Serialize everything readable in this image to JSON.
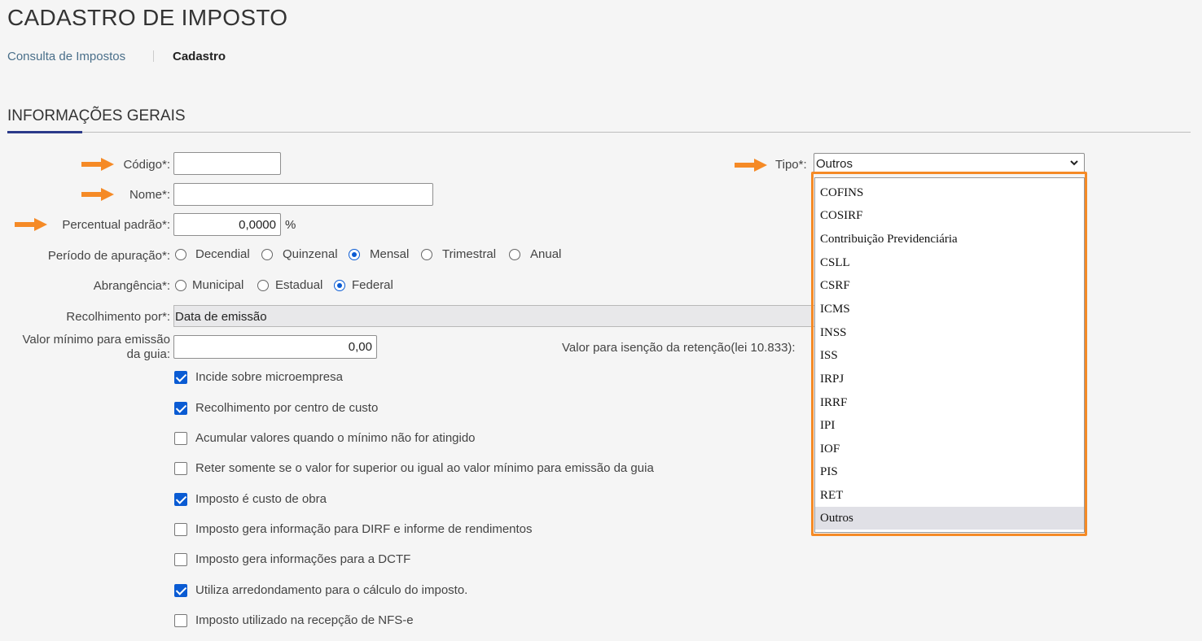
{
  "header": {
    "title": "CADASTRO DE IMPOSTO",
    "breadcrumb_link": "Consulta de Impostos",
    "breadcrumb_current": "Cadastro"
  },
  "section": {
    "title": "INFORMAÇÕES GERAIS"
  },
  "form": {
    "codigo_label": "Código*:",
    "codigo_value": "",
    "nome_label": "Nome*:",
    "nome_value": "",
    "percentual_label": "Percentual padrão*:",
    "percentual_value": "0,0000",
    "percentual_unit": "%",
    "periodo_label": "Período de apuração*:",
    "periodo_options": [
      "Decendial",
      "Quinzenal",
      "Mensal",
      "Trimestral",
      "Anual"
    ],
    "periodo_selected": "Mensal",
    "abrangencia_label": "Abrangência*:",
    "abrangencia_options": [
      "Municipal",
      "Estadual",
      "Federal"
    ],
    "abrangencia_selected": "Federal",
    "recolhimento_label": "Recolhimento por*:",
    "recolhimento_value": "Data de emissão",
    "valor_minimo_label_1": "Valor mínimo para emissão",
    "valor_minimo_label_2": "da guia:",
    "valor_minimo_value": "0,00",
    "valor_isencao_label": "Valor para isenção da retenção(lei 10.833):",
    "tipo_label": "Tipo*:",
    "tipo_value": "Outros"
  },
  "checkboxes": [
    {
      "label": "Incide sobre microempresa",
      "checked": true
    },
    {
      "label": "Recolhimento por centro de custo",
      "checked": true
    },
    {
      "label": "Acumular valores quando o mínimo não for atingido",
      "checked": false
    },
    {
      "label": "Reter somente se o valor for superior ou igual ao valor mínimo para emissão da guia",
      "checked": false
    },
    {
      "label": "Imposto é custo de obra",
      "checked": true
    },
    {
      "label": "Imposto gera informação para DIRF e informe de rendimentos",
      "checked": false
    },
    {
      "label": "Imposto gera informações para a DCTF",
      "checked": false
    },
    {
      "label": "Utiliza arredondamento para o cálculo do imposto.",
      "checked": true
    },
    {
      "label": "Imposto utilizado na recepção de NFS-e",
      "checked": false
    }
  ],
  "tipo_dropdown": {
    "options": [
      "COFINS",
      "COSIRF",
      "Contribuição Previdenciária",
      "CSLL",
      "CSRF",
      "ICMS",
      "INSS",
      "ISS",
      "IRPJ",
      "IRRF",
      "IPI",
      "IOF",
      "PIS",
      "RET",
      "Outros"
    ],
    "selected": "Outros"
  },
  "colors": {
    "annotation_orange": "#f58a26",
    "accent_blue": "#0a5bd3",
    "section_accent": "#2b3a8a"
  }
}
